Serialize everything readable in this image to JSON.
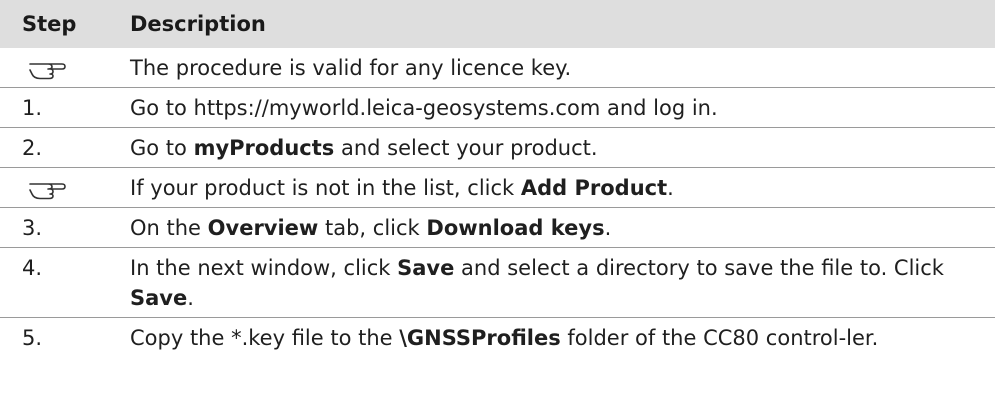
{
  "header": {
    "step": "Step",
    "description": "Description"
  },
  "rows": [
    {
      "step": "",
      "icon": "pointing-hand-icon",
      "parts": [
        {
          "t": "The procedure is valid for any licence key.",
          "b": false
        }
      ]
    },
    {
      "step": "1.",
      "parts": [
        {
          "t": "Go to https://myworld.leica-geosystems.com and log in.",
          "b": false
        }
      ]
    },
    {
      "step": "2.",
      "parts": [
        {
          "t": "Go to ",
          "b": false
        },
        {
          "t": "myProducts",
          "b": true
        },
        {
          "t": " and select your product.",
          "b": false
        }
      ]
    },
    {
      "step": "",
      "icon": "pointing-hand-icon",
      "parts": [
        {
          "t": "If your product is not in the list, click ",
          "b": false
        },
        {
          "t": "Add Product",
          "b": true
        },
        {
          "t": ".",
          "b": false
        }
      ]
    },
    {
      "step": "3.",
      "parts": [
        {
          "t": "On the ",
          "b": false
        },
        {
          "t": "Overview",
          "b": true
        },
        {
          "t": " tab, click ",
          "b": false
        },
        {
          "t": "Download keys",
          "b": true
        },
        {
          "t": ".",
          "b": false
        }
      ]
    },
    {
      "step": "4.",
      "parts": [
        {
          "t": "In the next window, click ",
          "b": false
        },
        {
          "t": "Save",
          "b": true
        },
        {
          "t": " and select a directory to save the file to. Click ",
          "b": false
        },
        {
          "t": "Save",
          "b": true
        },
        {
          "t": ".",
          "b": false
        }
      ]
    },
    {
      "step": "5.",
      "parts": [
        {
          "t": "Copy the *.key file to the ",
          "b": false
        },
        {
          "t": "\\GNSSProfiles",
          "b": true
        },
        {
          "t": " folder of the CC80 control-ler.",
          "b": false
        }
      ]
    }
  ]
}
